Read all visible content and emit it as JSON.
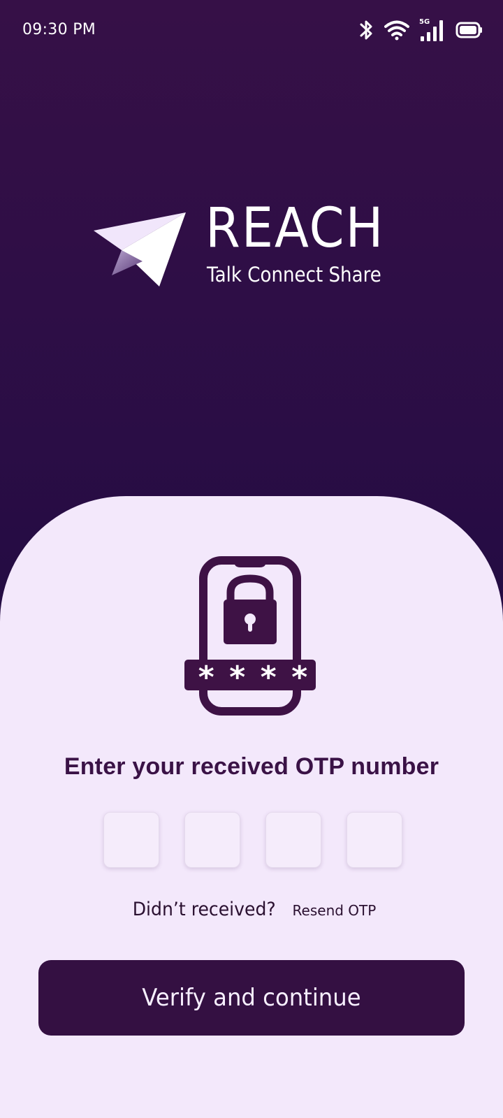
{
  "status_bar": {
    "time": "09:30 PM",
    "network_label": "5G",
    "icons": [
      "bluetooth-icon",
      "wifi-icon",
      "cellular-signal-icon",
      "battery-icon"
    ]
  },
  "brand": {
    "name": "REACH",
    "tagline": "Talk Connect Share",
    "logo_icon": "paper-plane-icon"
  },
  "otp": {
    "illustration_icon": "phone-lock-icon",
    "masked_code": "****",
    "title": "Enter your received OTP number",
    "digits": [
      "",
      "",
      "",
      ""
    ],
    "resend_question": "Didn’t received?",
    "resend_link": "Resend OTP",
    "verify_button": "Verify and continue"
  },
  "colors": {
    "background_top": "#361047",
    "background_bottom": "#160a3b",
    "sheet": "#f3e8fb",
    "primary": "#341042",
    "title_text": "#3a1246"
  }
}
